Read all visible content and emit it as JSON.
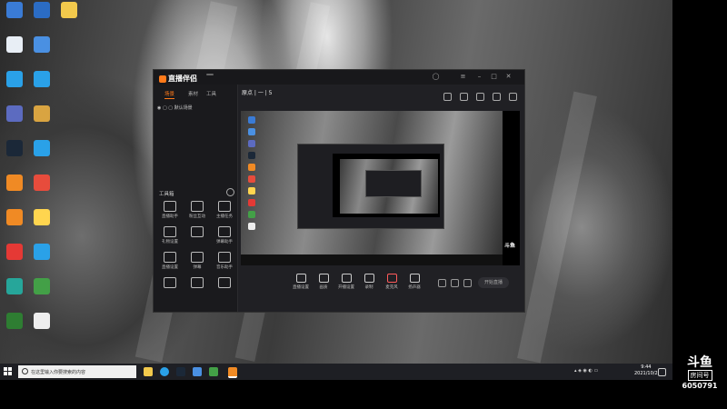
{
  "desktop_icons": [
    {
      "label": "",
      "color": "#3a7bd5"
    },
    {
      "label": "",
      "color": "#2b6cc4"
    },
    {
      "label": "",
      "color": "#f2c94c"
    },
    {
      "label": "",
      "color": "#e8eef5"
    },
    {
      "label": "",
      "color": "#4a90e2"
    },
    {
      "label": "",
      "color": "#2aa1e8"
    },
    {
      "label": "",
      "color": "#2aa1e8"
    },
    {
      "label": "",
      "color": "#5c6bc0"
    },
    {
      "label": "",
      "color": "#d9a441"
    },
    {
      "label": "",
      "color": "#1b2838"
    },
    {
      "label": "",
      "color": "#2aa1e8"
    },
    {
      "label": "",
      "color": "#f08a24"
    },
    {
      "label": "",
      "color": "#e74c3c"
    },
    {
      "label": "",
      "color": "#f08a24"
    },
    {
      "label": "",
      "color": "#ffd54f"
    },
    {
      "label": "",
      "color": "#e53935"
    },
    {
      "label": "",
      "color": "#2aa1e8"
    },
    {
      "label": "",
      "color": "#26a69a"
    },
    {
      "label": "",
      "color": "#43a047"
    },
    {
      "label": "",
      "color": "#2e7d32"
    },
    {
      "label": "",
      "color": "#eeeeee"
    }
  ],
  "app": {
    "name": "直播伴侣",
    "version": "",
    "accent": "#ff7a1a",
    "left_tabs": [
      "场景",
      "素材",
      "工具"
    ],
    "scene_label": "默认场景",
    "tools_header": "工具箱",
    "tools": [
      "直播助手",
      "粉丝互动",
      "主播任务",
      "礼物设置",
      "",
      "弹幕助手",
      "直播设置",
      "弹幕",
      "音乐助手",
      "",
      "",
      ""
    ],
    "left_footer": "",
    "title": "原点 | 一 | 5",
    "title_badge": "",
    "subtitle": "",
    "controls": [
      "直播设置",
      "画质",
      "开播设置",
      "录制",
      "麦克风",
      "扬声器"
    ],
    "start_button": "开始直播"
  },
  "taskbar": {
    "search_placeholder": "在这里输入你要搜索的内容",
    "tray_text": "",
    "time": "9:44",
    "date": "2021/10/2"
  },
  "watermark": {
    "logo": "斗鱼",
    "sub": "房间号",
    "room": "6050791"
  }
}
